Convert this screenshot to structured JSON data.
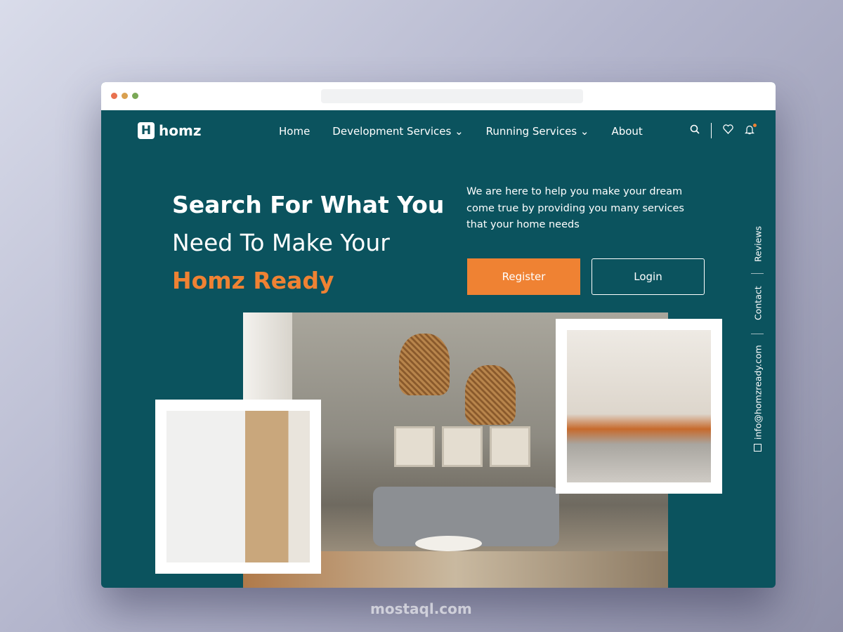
{
  "browser": {
    "dots": [
      "#e8714f",
      "#d9a04f",
      "#7aa856"
    ]
  },
  "nav": {
    "logo_mark": "H",
    "logo_text": "homz",
    "items": [
      {
        "label": "Home"
      },
      {
        "label": "Development Services ⌄"
      },
      {
        "label": "Running Services ⌄"
      },
      {
        "label": "About"
      }
    ],
    "icons": [
      "search-icon",
      "heart-icon",
      "bell-icon"
    ]
  },
  "hero": {
    "line1": "Search For What You",
    "line2": "Need To Make Your",
    "line3": "Homz Ready",
    "description": "We are here to help you make your dream come true by providing you many services that your home needs",
    "register": "Register",
    "login": "Login"
  },
  "side": {
    "reviews": "Reviews",
    "contact": "Contact",
    "email": "info@homzready.com"
  },
  "colors": {
    "teal": "#0b535e",
    "accent": "#ef8233"
  },
  "watermark": "mostaql.com"
}
